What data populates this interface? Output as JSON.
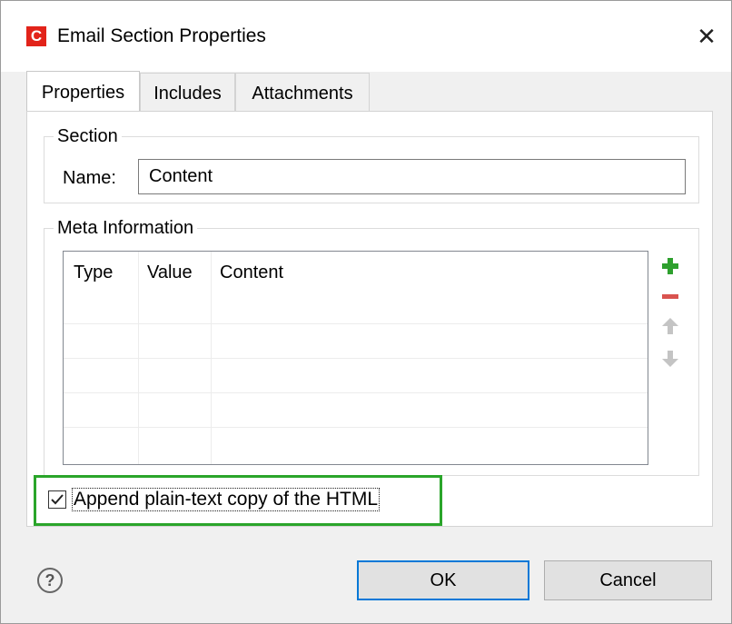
{
  "window": {
    "title": "Email Section Properties",
    "app_icon_letter": "C",
    "close_glyph": "✕"
  },
  "tabs": [
    {
      "label": "Properties",
      "active": true
    },
    {
      "label": "Includes",
      "active": false
    },
    {
      "label": "Attachments",
      "active": false
    }
  ],
  "section": {
    "legend": "Section",
    "name_label": "Name:",
    "name_value": "Content"
  },
  "meta": {
    "legend": "Meta Information",
    "columns": [
      "Type",
      "Value",
      "Content"
    ],
    "rows": [],
    "buttons": [
      {
        "name": "add-icon",
        "color": "#2ea02e"
      },
      {
        "name": "remove-icon",
        "color": "#d9534f"
      },
      {
        "name": "move-up-icon",
        "color": "#b0b0b0"
      },
      {
        "name": "move-down-icon",
        "color": "#b0b0b0"
      }
    ]
  },
  "append_plain_text": {
    "label": "Append plain-text copy of the HTML",
    "checked": true,
    "highlight_color": "#2aa52a"
  },
  "footer": {
    "help_glyph": "?",
    "ok_label": "OK",
    "cancel_label": "Cancel"
  },
  "colors": {
    "accent": "#0078d7",
    "app_icon": "#e2231a"
  }
}
